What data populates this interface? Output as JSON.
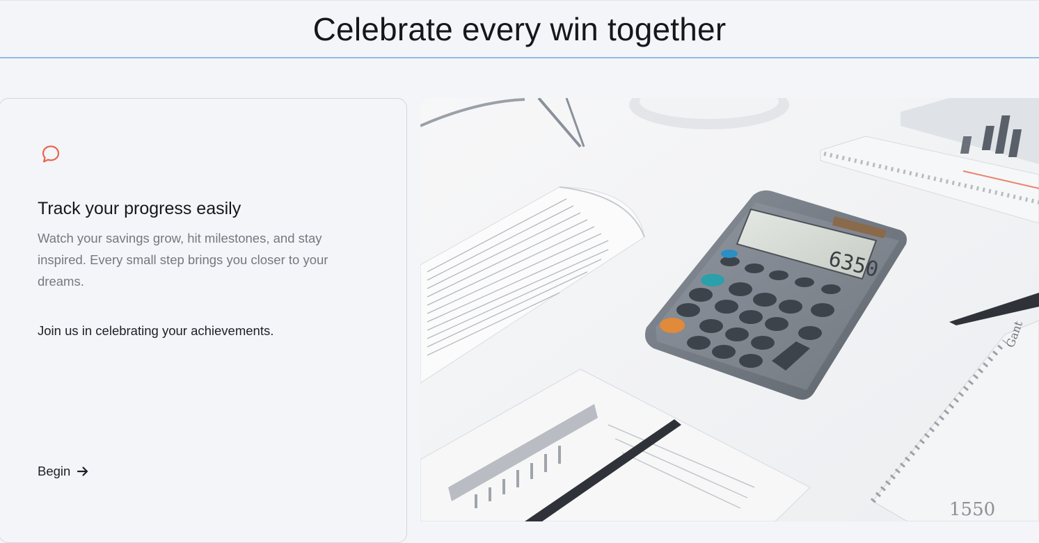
{
  "header": {
    "title": "Celebrate every win together"
  },
  "feature_card": {
    "icon": "chat-bubble-icon",
    "title": "Track your progress easily",
    "description": "Watch your savings grow, hit milestones, and stay inspired. Every small step brings you closer to your dreams.",
    "note": "Join us in celebrating your achievements.",
    "cta_label": "Begin",
    "cta_icon": "arrow-right-icon"
  },
  "hero": {
    "calculator_display": "6350",
    "paper_text_1": "1550",
    "paper_text_2": "Gant"
  },
  "colors": {
    "accent": "#e8644f",
    "divider": "#8fbde8",
    "background": "#f4f5f8"
  }
}
